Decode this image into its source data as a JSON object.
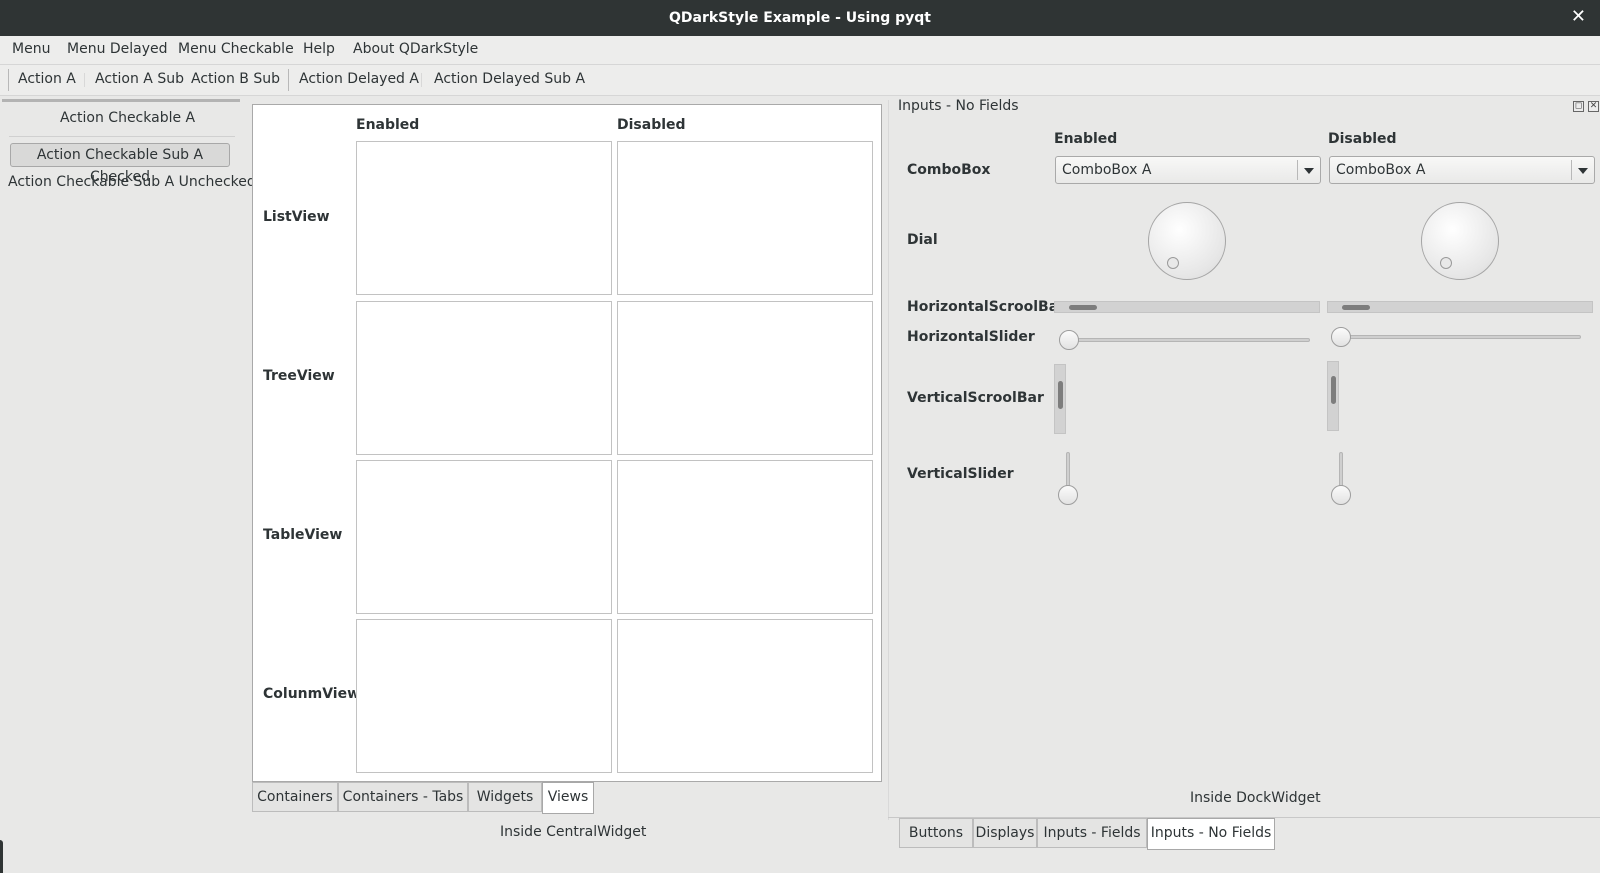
{
  "window": {
    "title": "QDarkStyle Example - Using pyqt",
    "close_glyph": "✕"
  },
  "menubar": {
    "items": [
      "Menu",
      "Menu Delayed",
      "Menu Checkable",
      "Help",
      "About QDarkStyle"
    ]
  },
  "toolbar": {
    "items": [
      "Action A",
      "Action A Sub",
      "Action B Sub",
      "Action Delayed A",
      "Action Delayed Sub A"
    ]
  },
  "left_toolbar": {
    "checkable_a": "Action Checkable A",
    "sub_checked": "Action Checkable Sub A Checked",
    "sub_unchecked": "Action Checkable Sub A Unchecked"
  },
  "central": {
    "col_enabled": "Enabled",
    "col_disabled": "Disabled",
    "rows": [
      "ListView",
      "TreeView",
      "TableView",
      "ColunmView"
    ],
    "tabs": [
      "Containers",
      "Containers - Tabs",
      "Widgets",
      "Views"
    ],
    "active_tab": "Views",
    "caption": "Inside CentralWidget"
  },
  "dock": {
    "title": "Inputs - No Fields",
    "col_enabled": "Enabled",
    "col_disabled": "Disabled",
    "labels": [
      "ComboBox",
      "Dial",
      "HorizontalScroolBar",
      "HorizontalSlider",
      "VerticalScroolBar",
      "VerticalSlider"
    ],
    "combo_enabled_value": "ComboBox A",
    "combo_disabled_value": "ComboBox A",
    "caption": "Inside DockWidget",
    "tabs": [
      "Buttons",
      "Displays",
      "Inputs - Fields",
      "Inputs - No Fields"
    ],
    "active_tab": "Inputs - No Fields",
    "float_glyph": "◻",
    "close_glyph": "✕"
  }
}
